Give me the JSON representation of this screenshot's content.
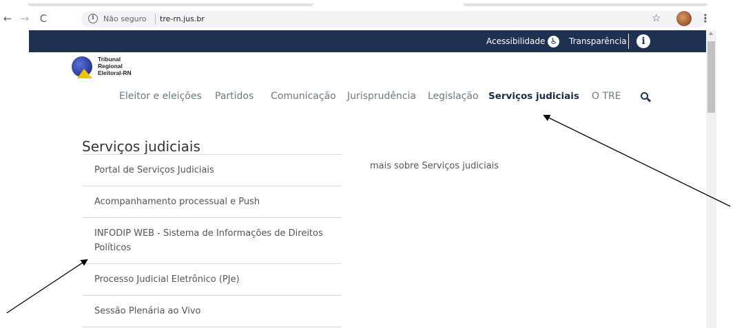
{
  "browser": {
    "back_icon": "arrow-left-icon",
    "forward_icon": "arrow-right-icon",
    "reload_icon": "reload-icon",
    "info_icon": "info-circle-icon",
    "security_label": "Não seguro",
    "url": "tre-rn.jus.br",
    "bookmark_icon": "star-icon",
    "profile_icon": "avatar",
    "menu_icon": "more-vert-icon"
  },
  "topbar": {
    "accessibility_label": "Acessibilidade",
    "accessibility_icon": "accessibility-icon",
    "transparency_label": "Transparência",
    "info_icon": "info-icon",
    "background_color": "#1f3251"
  },
  "logo": {
    "line1": "Tribunal",
    "line2": "Regional",
    "line3": "Eleitoral-RN"
  },
  "nav": {
    "items": [
      {
        "label": "Eleitor e eleições"
      },
      {
        "label": "Partidos"
      },
      {
        "label": "Comunicação"
      },
      {
        "label": "Jurisprudência"
      },
      {
        "label": "Legislação"
      },
      {
        "label": "Serviços judiciais",
        "active": true
      },
      {
        "label": "O TRE"
      }
    ],
    "search_icon": "search-icon"
  },
  "submenu": {
    "title": "Serviços judiciais",
    "items": [
      {
        "label": "Portal de Serviços Judiciais"
      },
      {
        "label": "Acompanhamento processual e Push"
      },
      {
        "label": "INFODIP WEB - Sistema de Informações de Direitos Políticos"
      },
      {
        "label": "Processo Judicial Eletrônico (PJe)"
      },
      {
        "label": "Sessão Plenária ao Vivo"
      }
    ],
    "more_link": "mais sobre Serviços judiciais"
  }
}
